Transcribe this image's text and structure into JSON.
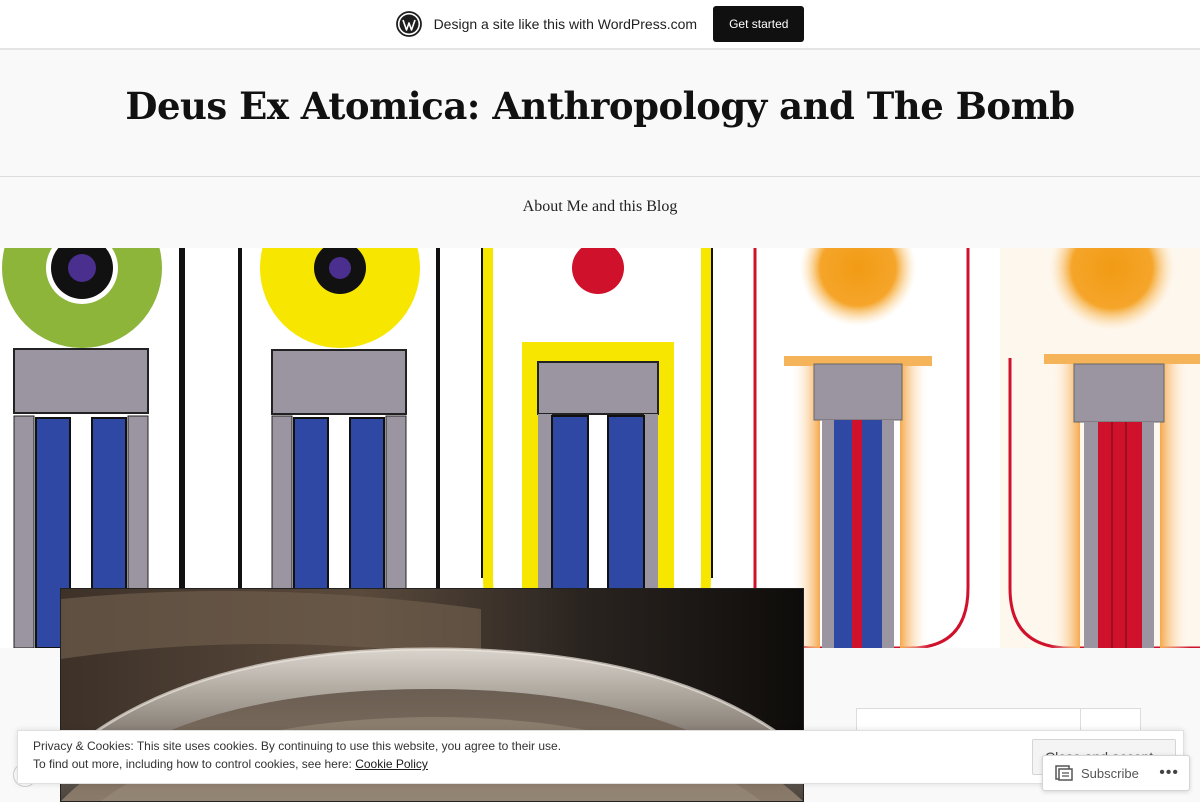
{
  "wp_bar": {
    "text": "Design a site like this with WordPress.com",
    "button_label": "Get started",
    "logo_icon": "wordpress-logo-icon"
  },
  "header": {
    "site_title": "Deus Ex Atomica: Anthropology and The Bomb",
    "nav_items": [
      {
        "label": "About Me and this Blog"
      }
    ]
  },
  "cookie_banner": {
    "line1": "Privacy & Cookies: This site uses cookies. By continuing to use this website, you agree to their use.",
    "line2_prefix": "To find out more, including how to control cookies, see here:",
    "link_label": "Cookie Policy",
    "close_button_label": "Close and accept"
  },
  "subscribe": {
    "label": "Subscribe",
    "icon": "subscribe-icon",
    "more_icon": "more-icon"
  },
  "colors": {
    "wp_bar_bg": "#ffffff",
    "button_dark": "#101010",
    "page_bg": "#f9f9f9",
    "poster_blue": "#2f48a3",
    "poster_grey": "#9a95a0",
    "poster_green": "#8cb53a",
    "poster_yellow": "#f7e600",
    "poster_red": "#d0112b",
    "poster_orange": "#f29b14"
  }
}
